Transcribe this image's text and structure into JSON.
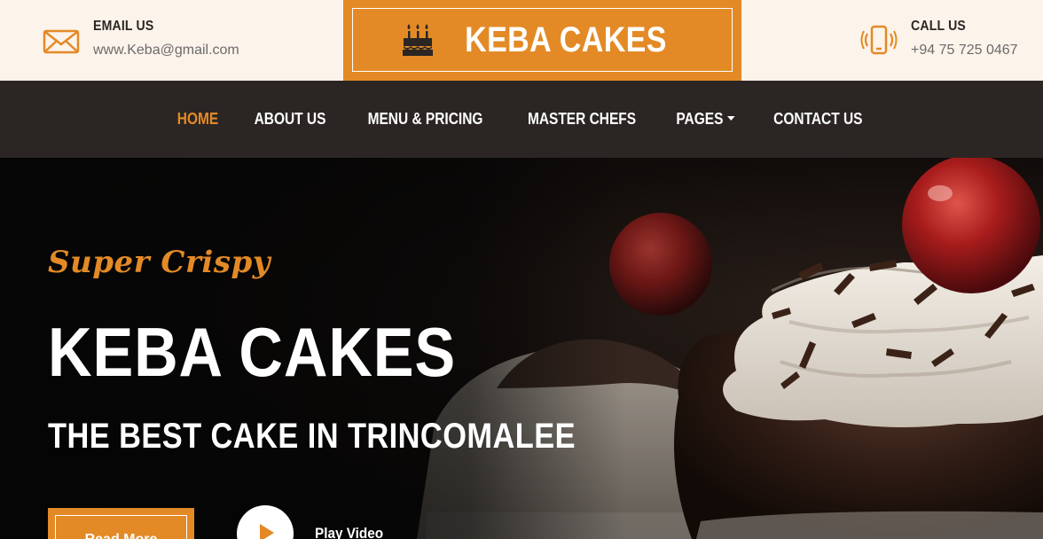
{
  "topbar": {
    "email": {
      "label": "EMAIL US",
      "value": "www.Keba@gmail.com",
      "icon": "envelope-icon"
    },
    "call": {
      "label": "CALL US",
      "value": "+94 75 725 0467",
      "icon": "phone-icon"
    }
  },
  "brand": {
    "name": "KEBA CAKES",
    "icon": "birthday-cake-icon",
    "color": "#e38a26"
  },
  "nav": {
    "items": [
      {
        "label": "HOME",
        "active": true
      },
      {
        "label": "ABOUT US"
      },
      {
        "label": "MENU & PRICING"
      },
      {
        "label": "MASTER CHEFS"
      },
      {
        "label": "PAGES",
        "dropdown": true
      },
      {
        "label": "CONTACT US"
      }
    ]
  },
  "hero": {
    "tagline": "Super Crispy",
    "title": "KEBA CAKES",
    "subtitle": "THE BEST CAKE IN TRINCOMALEE",
    "read_more": "Read More",
    "play_video": "Play Video"
  },
  "colors": {
    "accent": "#e38a26",
    "dark": "#2b2623",
    "cream": "#fcf3ea"
  }
}
